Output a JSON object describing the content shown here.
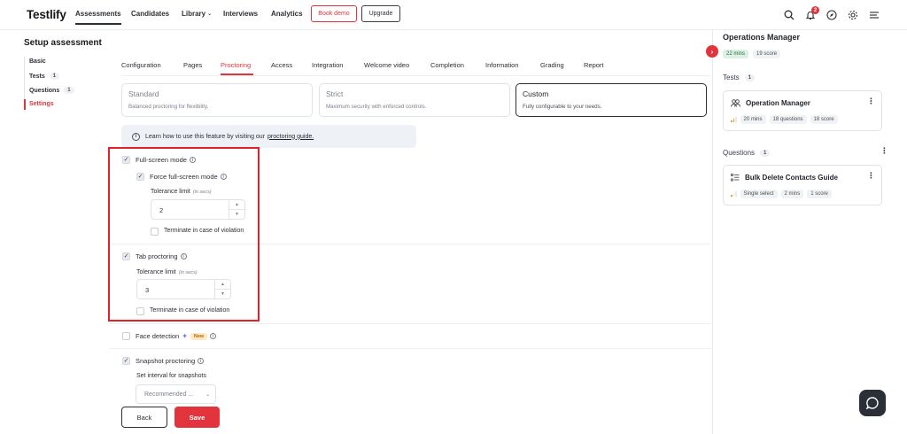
{
  "brand": {
    "logo": "Testlify"
  },
  "nav": {
    "items": [
      "Assessments",
      "Candidates",
      "Library",
      "Interviews",
      "Analytics"
    ],
    "book_demo": "Book demo",
    "upgrade": "Upgrade",
    "notification_count": "2"
  },
  "page": {
    "title": "Setup assessment"
  },
  "sidebar": {
    "items": [
      {
        "label": "Basic"
      },
      {
        "label": "Tests",
        "count": "1"
      },
      {
        "label": "Questions",
        "count": "1"
      },
      {
        "label": "Settings"
      }
    ]
  },
  "tabs": [
    "Configuration",
    "Pages",
    "Proctoring",
    "Access",
    "Integration",
    "Welcome video",
    "Completion",
    "Information",
    "Grading",
    "Report"
  ],
  "modes": [
    {
      "title": "Standard",
      "desc": "Balanced proctoring for flexibility."
    },
    {
      "title": "Strict",
      "desc": "Maximum security with enforced controls."
    },
    {
      "title": "Custom",
      "desc": "Fully configurable to your needs."
    }
  ],
  "info": {
    "text": "Learn how to use this feature by visiting our",
    "link": "proctoring guide."
  },
  "fullscreen": {
    "label": "Full-screen mode",
    "force_label": "Force full-screen mode",
    "tolerance_label": "Tolerance limit",
    "tolerance_unit": "(in secs)",
    "tolerance_value": "2",
    "terminate_label": "Terminate in case of violation"
  },
  "tab_proctoring": {
    "label": "Tab proctoring",
    "tolerance_label": "Tolerance limit",
    "tolerance_unit": "(in secs)",
    "tolerance_value": "3",
    "terminate_label": "Terminate in case of violation"
  },
  "face_detection": {
    "label": "Face detection",
    "badge": "New"
  },
  "snapshot": {
    "label": "Snapshot proctoring",
    "interval_label": "Set interval for snapshots",
    "interval_value": "Recommended ..."
  },
  "actions": {
    "back": "Back",
    "save": "Save"
  },
  "right_panel": {
    "title": "Operations Manager",
    "chips": [
      "22 mins",
      "19 score"
    ],
    "tests_label": "Tests",
    "tests_count": "1",
    "test_card": {
      "title": "Operation Manager",
      "chips": [
        "20 mins",
        "18 questions",
        "18 score"
      ]
    },
    "questions_label": "Questions",
    "questions_count": "1",
    "question_card": {
      "title": "Bulk Delete Contacts Guide",
      "chips": [
        "Single select",
        "2 mins",
        "1 score"
      ]
    }
  },
  "colors": {
    "accent": "#e1343c",
    "highlight": "#e0232b"
  }
}
